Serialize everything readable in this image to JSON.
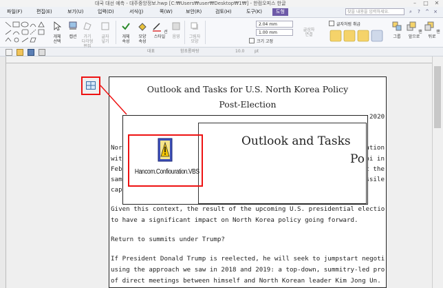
{
  "window": {
    "title": "대국 대선 예측 - 대주중앙정보.hwp [C:₩Users₩user₩Desktop₩1₩] - 한컴오피스 한글",
    "min_glyph": "–",
    "max_glyph": "□",
    "close_glyph": "✕"
  },
  "menu": {
    "items": [
      "파일(F)",
      "편집(E)",
      "보기(U)",
      "입력(D)",
      "서식(J)",
      "쪽(W)",
      "보안(R)",
      "검토(H)",
      "도구(K)",
      "도형"
    ],
    "search_placeholder": "찾을 내용을 입력하세요."
  },
  "ribbon": {
    "groups": [
      {
        "label": "개체\n선택",
        "disabled": false
      },
      {
        "label": "캡션",
        "disabled": false
      },
      {
        "label": "가기\n다각형\n편집",
        "disabled": true
      },
      {
        "label": "글자\n넣기",
        "disabled": true
      },
      {
        "label": "개체\n속성",
        "disabled": false
      },
      {
        "label": "모양\n속성",
        "disabled": false
      },
      {
        "label": "선\n스타일",
        "disabled": false
      },
      {
        "label": "음영",
        "disabled": true
      },
      {
        "label": "그림자\n모양",
        "disabled": true
      },
      {
        "label": "글상자\n연결",
        "disabled": true
      },
      {
        "label": "그룹",
        "disabled": false
      },
      {
        "label": "맨\n앞으로",
        "disabled": false
      },
      {
        "label": "맨\n뒤로",
        "disabled": false
      }
    ],
    "width_value": "2.04 mm",
    "height_value": "1.00 mm",
    "size_fixed_label": "크기 고정",
    "treat_as_char_label": "글자처럼 취급"
  },
  "toolbar": {
    "style_label": "대표",
    "font_label": "함초롬바탕",
    "size_label": "10.0",
    "unit_label": "pt"
  },
  "document": {
    "title_line1": "Outlook and Tasks for U.S. North Korea Policy",
    "title_line2": "Post-Election",
    "date_fragment": "2020",
    "left_fragments": [
      "Nor",
      "with",
      "Feb",
      "sam",
      "cap"
    ],
    "right_fragments": [
      "cation",
      "oi in",
      "at the",
      "issile"
    ],
    "para1_line1": "Given this context, the result of the upcoming U.S. presidential electionis expected",
    "para1_line2": "to have a significant impact on North Korea policy going forward.",
    "para2": "Return to summits under Trump?",
    "para3_line1": "If President Donald Trump is reelected, he will seek to jumpstart negotiations",
    "para3_line2": "using the approach we saw in 2018 and 2019: a top-down, summitry-led process",
    "para3_line3": "of direct meetings between himself and North Korean leader Kim Jong Un."
  },
  "embedded_preview": {
    "title_fragment": "Outlook and Tasks",
    "sub_fragment": "Po"
  },
  "ole_object": {
    "label": "Hancom.Confiouration.VBS",
    "icon": "warning-script-icon"
  },
  "colors": {
    "accent": "#6d5aa8",
    "annotation_red": "#e11111"
  }
}
